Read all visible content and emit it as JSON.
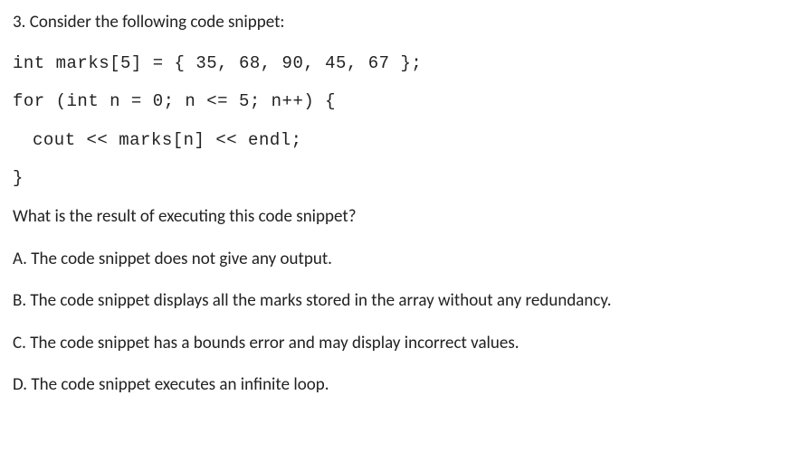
{
  "question": {
    "number_prompt": "3. Consider the following code snippet:",
    "code": {
      "line1": "int marks[5] = { 35, 68, 90, 45, 67 };",
      "line2": "for (int n = 0; n <= 5; n++) {",
      "line3": "cout << marks[n] << endl;",
      "line4": "}"
    },
    "sub_question": "What is the result of executing this code snippet?",
    "options": {
      "a": "A. The code snippet does not give any output.",
      "b": "B. The code snippet displays all the marks stored in the array without any redundancy.",
      "c": "C. The code snippet has a bounds error and may display incorrect values.",
      "d": "D. The code snippet executes an infinite loop."
    }
  }
}
